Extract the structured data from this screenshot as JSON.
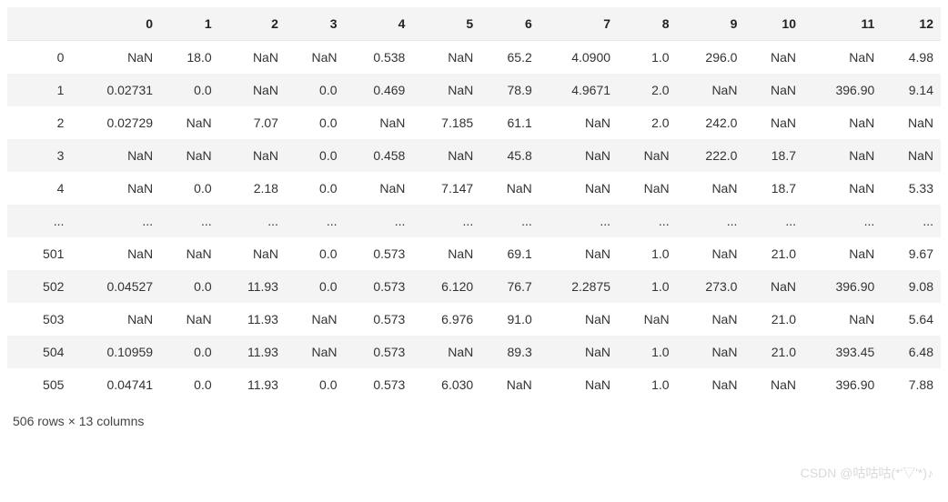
{
  "chart_data": {
    "type": "table",
    "title": "",
    "columns": [
      "0",
      "1",
      "2",
      "3",
      "4",
      "5",
      "6",
      "7",
      "8",
      "9",
      "10",
      "11",
      "12"
    ],
    "row_index": [
      "0",
      "1",
      "2",
      "3",
      "4",
      "...",
      "501",
      "502",
      "503",
      "504",
      "505"
    ],
    "rows": [
      [
        "NaN",
        "18.0",
        "NaN",
        "NaN",
        "0.538",
        "NaN",
        "65.2",
        "4.0900",
        "1.0",
        "296.0",
        "NaN",
        "NaN",
        "4.98"
      ],
      [
        "0.02731",
        "0.0",
        "NaN",
        "0.0",
        "0.469",
        "NaN",
        "78.9",
        "4.9671",
        "2.0",
        "NaN",
        "NaN",
        "396.90",
        "9.14"
      ],
      [
        "0.02729",
        "NaN",
        "7.07",
        "0.0",
        "NaN",
        "7.185",
        "61.1",
        "NaN",
        "2.0",
        "242.0",
        "NaN",
        "NaN",
        "NaN"
      ],
      [
        "NaN",
        "NaN",
        "NaN",
        "0.0",
        "0.458",
        "NaN",
        "45.8",
        "NaN",
        "NaN",
        "222.0",
        "18.7",
        "NaN",
        "NaN"
      ],
      [
        "NaN",
        "0.0",
        "2.18",
        "0.0",
        "NaN",
        "7.147",
        "NaN",
        "NaN",
        "NaN",
        "NaN",
        "18.7",
        "NaN",
        "5.33"
      ],
      [
        "...",
        "...",
        "...",
        "...",
        "...",
        "...",
        "...",
        "...",
        "...",
        "...",
        "...",
        "...",
        "..."
      ],
      [
        "NaN",
        "NaN",
        "NaN",
        "0.0",
        "0.573",
        "NaN",
        "69.1",
        "NaN",
        "1.0",
        "NaN",
        "21.0",
        "NaN",
        "9.67"
      ],
      [
        "0.04527",
        "0.0",
        "11.93",
        "0.0",
        "0.573",
        "6.120",
        "76.7",
        "2.2875",
        "1.0",
        "273.0",
        "NaN",
        "396.90",
        "9.08"
      ],
      [
        "NaN",
        "NaN",
        "11.93",
        "NaN",
        "0.573",
        "6.976",
        "91.0",
        "NaN",
        "NaN",
        "NaN",
        "21.0",
        "NaN",
        "5.64"
      ],
      [
        "0.10959",
        "0.0",
        "11.93",
        "NaN",
        "0.573",
        "NaN",
        "89.3",
        "NaN",
        "1.0",
        "NaN",
        "21.0",
        "393.45",
        "6.48"
      ],
      [
        "0.04741",
        "0.0",
        "11.93",
        "0.0",
        "0.573",
        "6.030",
        "NaN",
        "NaN",
        "1.0",
        "NaN",
        "NaN",
        "396.90",
        "7.88"
      ]
    ]
  },
  "summary_text": "506 rows × 13 columns",
  "watermark": "CSDN @咕咕咕(*'▽'*)♪"
}
